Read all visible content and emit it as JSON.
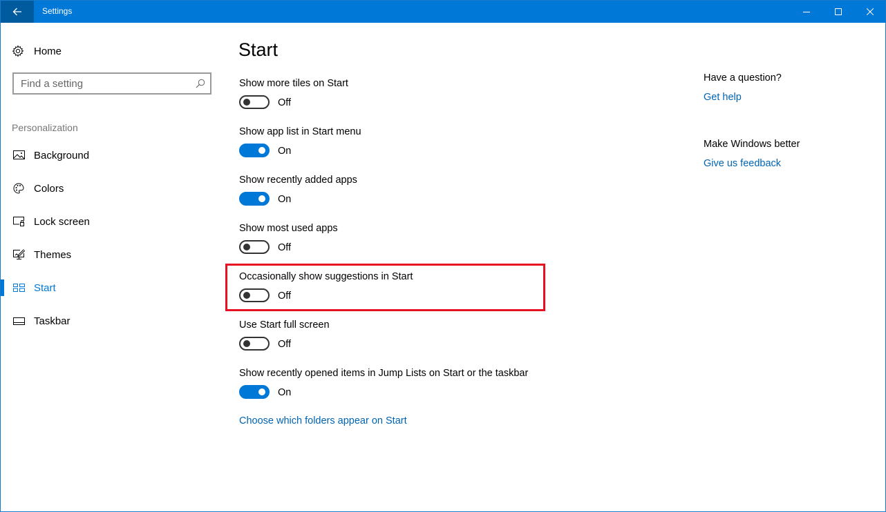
{
  "window": {
    "title": "Settings",
    "controls": {
      "minimize": "minimize-icon",
      "maximize": "maximize-icon",
      "close": "close-icon"
    },
    "back_icon": "back-arrow-icon"
  },
  "sidebar": {
    "home_label": "Home",
    "home_icon": "gear-icon",
    "search": {
      "placeholder": "Find a setting",
      "value": "",
      "icon": "search-icon"
    },
    "section_label": "Personalization",
    "items": [
      {
        "label": "Background",
        "icon": "background-image-icon",
        "active": false
      },
      {
        "label": "Colors",
        "icon": "palette-icon",
        "active": false
      },
      {
        "label": "Lock screen",
        "icon": "lock-screen-icon",
        "active": false
      },
      {
        "label": "Themes",
        "icon": "themes-icon",
        "active": false
      },
      {
        "label": "Start",
        "icon": "start-tiles-icon",
        "active": true
      },
      {
        "label": "Taskbar",
        "icon": "taskbar-icon",
        "active": false
      }
    ]
  },
  "main": {
    "title": "Start",
    "settings": [
      {
        "label": "Show more tiles on Start",
        "on": false,
        "state_label": "Off"
      },
      {
        "label": "Show app list in Start menu",
        "on": true,
        "state_label": "On"
      },
      {
        "label": "Show recently added apps",
        "on": true,
        "state_label": "On"
      },
      {
        "label": "Show most used apps",
        "on": false,
        "state_label": "Off"
      },
      {
        "label": "Occasionally show suggestions in Start",
        "on": false,
        "state_label": "Off",
        "highlighted": true
      },
      {
        "label": "Use Start full screen",
        "on": false,
        "state_label": "Off"
      },
      {
        "label": "Show recently opened items in Jump Lists on Start or the taskbar",
        "on": true,
        "state_label": "On"
      }
    ],
    "folders_link": "Choose which folders appear on Start"
  },
  "aside": {
    "question_heading": "Have a question?",
    "get_help_link": "Get help",
    "feedback_heading": "Make Windows better",
    "feedback_link": "Give us feedback"
  },
  "colors": {
    "accent": "#0078d7",
    "titlebar": "#0078d7",
    "back_button": "#005a9e",
    "link": "#0063b1",
    "highlight_box": "#e81123"
  }
}
